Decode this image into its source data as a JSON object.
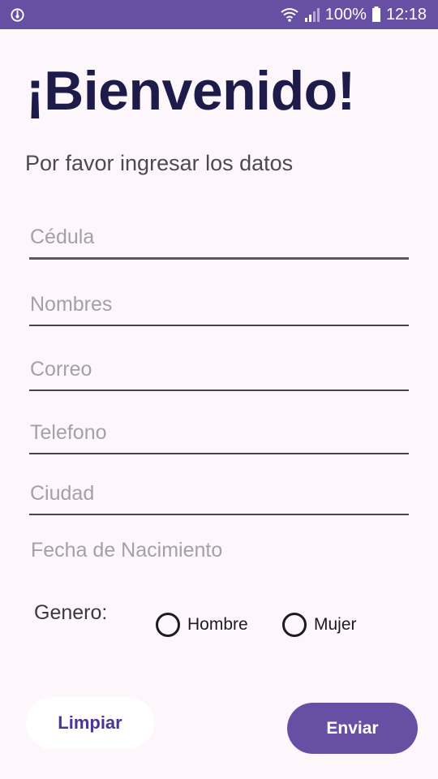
{
  "status_bar": {
    "battery": "100%",
    "time": "12:18",
    "background_color": "#6750a4"
  },
  "header": {
    "title": "¡Bienvenido!",
    "subtitle": "Por favor ingresar los datos"
  },
  "form": {
    "cedula": {
      "placeholder": "Cédula",
      "value": ""
    },
    "nombres": {
      "placeholder": "Nombres",
      "value": ""
    },
    "correo": {
      "placeholder": "Correo",
      "value": ""
    },
    "telefono": {
      "placeholder": "Telefono",
      "value": ""
    },
    "ciudad": {
      "placeholder": "Ciudad",
      "value": ""
    },
    "fecha_nacimiento": {
      "placeholder": "Fecha de Nacimiento",
      "value": ""
    },
    "genero": {
      "label": "Genero:",
      "options": [
        "Hombre",
        "Mujer"
      ],
      "selected": null
    }
  },
  "buttons": {
    "clear_label": "Limpiar",
    "send_label": "Enviar"
  },
  "colors": {
    "primary": "#6750a4",
    "title_text": "#1c1b4a",
    "background": "#fdf7fc"
  }
}
